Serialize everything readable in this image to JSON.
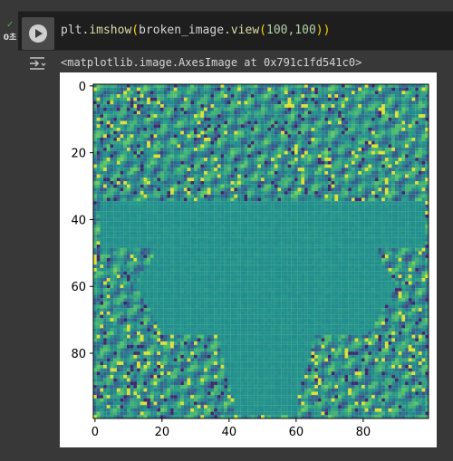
{
  "cell": {
    "status_icon": "check-icon",
    "exec_time": "0초",
    "run_button_icon": "play-icon",
    "code_tokens": {
      "obj": "plt.",
      "fn1": "imshow",
      "open1": "(",
      "arg_obj": "broken_image.",
      "fn2": "view",
      "open2": "(",
      "args": "100,100",
      "close2": ")",
      "close1": ")"
    }
  },
  "output": {
    "icon": "output-toggle-icon",
    "repr_text": "<matplotlib.image.AxesImage at 0x791c1fd541c0>"
  },
  "chart_data": {
    "type": "heatmap",
    "title": "",
    "xlabel": "",
    "ylabel": "",
    "rows": 100,
    "cols": 100,
    "xlim": [
      0,
      99
    ],
    "ylim": [
      99,
      0
    ],
    "xticks": [
      0,
      20,
      40,
      60,
      80
    ],
    "yticks": [
      0,
      20,
      40,
      60,
      80
    ],
    "colormap": "viridis",
    "colors": {
      "uniform_region": "#21918c",
      "low": "#440154",
      "high": "#fde725"
    }
  }
}
